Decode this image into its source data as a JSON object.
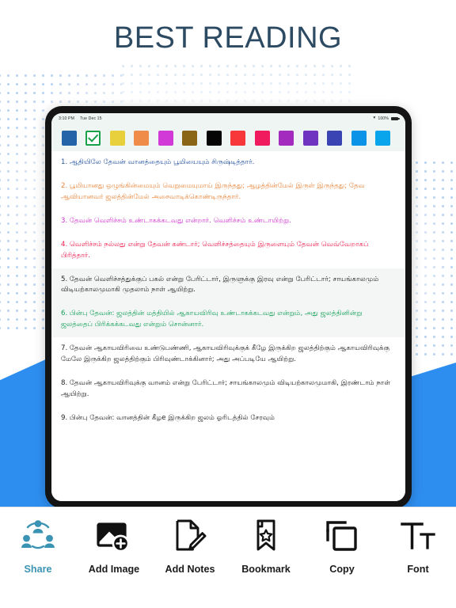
{
  "headline": {
    "text": "BEST READING"
  },
  "colors": {
    "accent_blue": "#2e8ef0",
    "headline": "#2d4a63",
    "share_teal": "#3b93b3",
    "selected_check": "#17a24a",
    "dot_pattern": "#b9d2ef",
    "tablet_bezel": "#141414",
    "screen_bg": "#eef5f3"
  },
  "tablet": {
    "status_bar": {
      "time": "3:10 PM",
      "date": "Tue Dec 15",
      "wifi_icon": "wifi-icon",
      "battery_percent": "100%",
      "battery_icon": "battery-full-icon"
    },
    "palette": {
      "selected_index": 1,
      "swatches": [
        {
          "name": "blue",
          "hex": "#2463a8",
          "selected": false
        },
        {
          "name": "selected-check",
          "hex": "#ffffff",
          "selected": true
        },
        {
          "name": "yellow",
          "hex": "#e8cf3c",
          "selected": false
        },
        {
          "name": "orange",
          "hex": "#ef8c4a",
          "selected": false
        },
        {
          "name": "magenta",
          "hex": "#d23ad8",
          "selected": false
        },
        {
          "name": "brown",
          "hex": "#8a6417",
          "selected": false
        },
        {
          "name": "black",
          "hex": "#050505",
          "selected": false
        },
        {
          "name": "red",
          "hex": "#f8373a",
          "selected": false
        },
        {
          "name": "pink",
          "hex": "#ef1b5e",
          "selected": false
        },
        {
          "name": "purple",
          "hex": "#a32cbe",
          "selected": false
        },
        {
          "name": "violet",
          "hex": "#6f34c0",
          "selected": false
        },
        {
          "name": "indigo",
          "hex": "#3a44b2",
          "selected": false
        },
        {
          "name": "sky-blue",
          "hex": "#0b93e8",
          "selected": false
        },
        {
          "name": "cyan-blue",
          "hex": "#08a5ec",
          "selected": false
        }
      ]
    },
    "verses": [
      {
        "number": "1",
        "color": "#2453a0",
        "highlighted": false,
        "text": "1. ஆதியிலே தேவன் வானத்தையும் பூமியையும் சிருஷ்டித்தார்."
      },
      {
        "number": "2",
        "color": "#e8863c",
        "highlighted": false,
        "text": "2. பூமியானது ஒழுங்கின்மையும் வெறுமையுமாய் இருந்தது; ஆழத்தின்மேல் இருள் இருந்தது; தேவ ஆவியானவர் ஜலத்தின்மேல் அசைவாடிக்கொண்டிருந்தார்."
      },
      {
        "number": "3",
        "color": "#cf33cf",
        "highlighted": false,
        "text": "3. தேவன் வெளிச்சம் உண்டாகக்கடவது என்றார். வெளிச்சம் உண்டாயிற்று."
      },
      {
        "number": "4",
        "color": "#ee2050",
        "highlighted": false,
        "text": "4. வெளிச்சம் நல்லது என்று தேவன் கண்டார்; வெளிச்சத்தையும் இருளையும் தேவன் வெவ்வேறாகப் பிரித்தார்."
      },
      {
        "number": "5",
        "color": "#232323",
        "highlighted": true,
        "text": "5. தேவன் வெளிச்சத்துக்குப் பகல் என்று பேரிட்டார், இருளுக்கு இரவு என்று பேரிட்டார்; சாயங்காலமும் விடியற்காலமுமாகி முதலாம் நாள் ஆயிற்று."
      },
      {
        "number": "6",
        "color": "#14a05a",
        "highlighted": true,
        "text": "6. பின்பு தேவன்: ஜலத்தின் மத்தியில் ஆகாயவிரிவு உண்டாகக்கடவது என்றும், அது ஜலத்தினின்று ஜலத்தைப் பிரிக்கக்கடவது என்றும் சொன்னார்."
      },
      {
        "number": "7",
        "color": "#232323",
        "highlighted": false,
        "text": "7. தேவன் ஆகாயவிரிவை உண்டுபண்ணி, ஆகாயவிரிவுக்குக் கீழே இருக்கிற ஜலத்திற்கும் ஆகாயவிரிவுக்கு மேலே இருக்கிற ஜலத்திற்கும் பிரிவுண்டாக்கினார்; அது அப்படியே ஆயிற்று."
      },
      {
        "number": "8",
        "color": "#232323",
        "highlighted": false,
        "text": "8. தேவன் ஆகாயவிரிவுக்கு வானம் என்று பேரிட்டார்; சாயங்காலமும் விடியற்காலமுமாகி, இரண்டாம் நாள் ஆயிற்று."
      },
      {
        "number": "9",
        "color": "#232323",
        "highlighted": false,
        "text": "9. பின்பு தேவன்: வானத்தின் கீழe இருக்கிற ஜலம் ஓரிடத்தில் சேரவும்"
      }
    ]
  },
  "toolbar": {
    "items": [
      {
        "label": "Share",
        "icon": "share-people-icon",
        "active": true
      },
      {
        "label": "Add Image",
        "icon": "add-image-icon",
        "active": false
      },
      {
        "label": "Add Notes",
        "icon": "note-pencil-icon",
        "active": false
      },
      {
        "label": "Bookmark",
        "icon": "bookmark-star-icon",
        "active": false
      },
      {
        "label": "Copy",
        "icon": "copy-icon",
        "active": false
      },
      {
        "label": "Font",
        "icon": "font-size-icon",
        "active": false
      }
    ]
  }
}
